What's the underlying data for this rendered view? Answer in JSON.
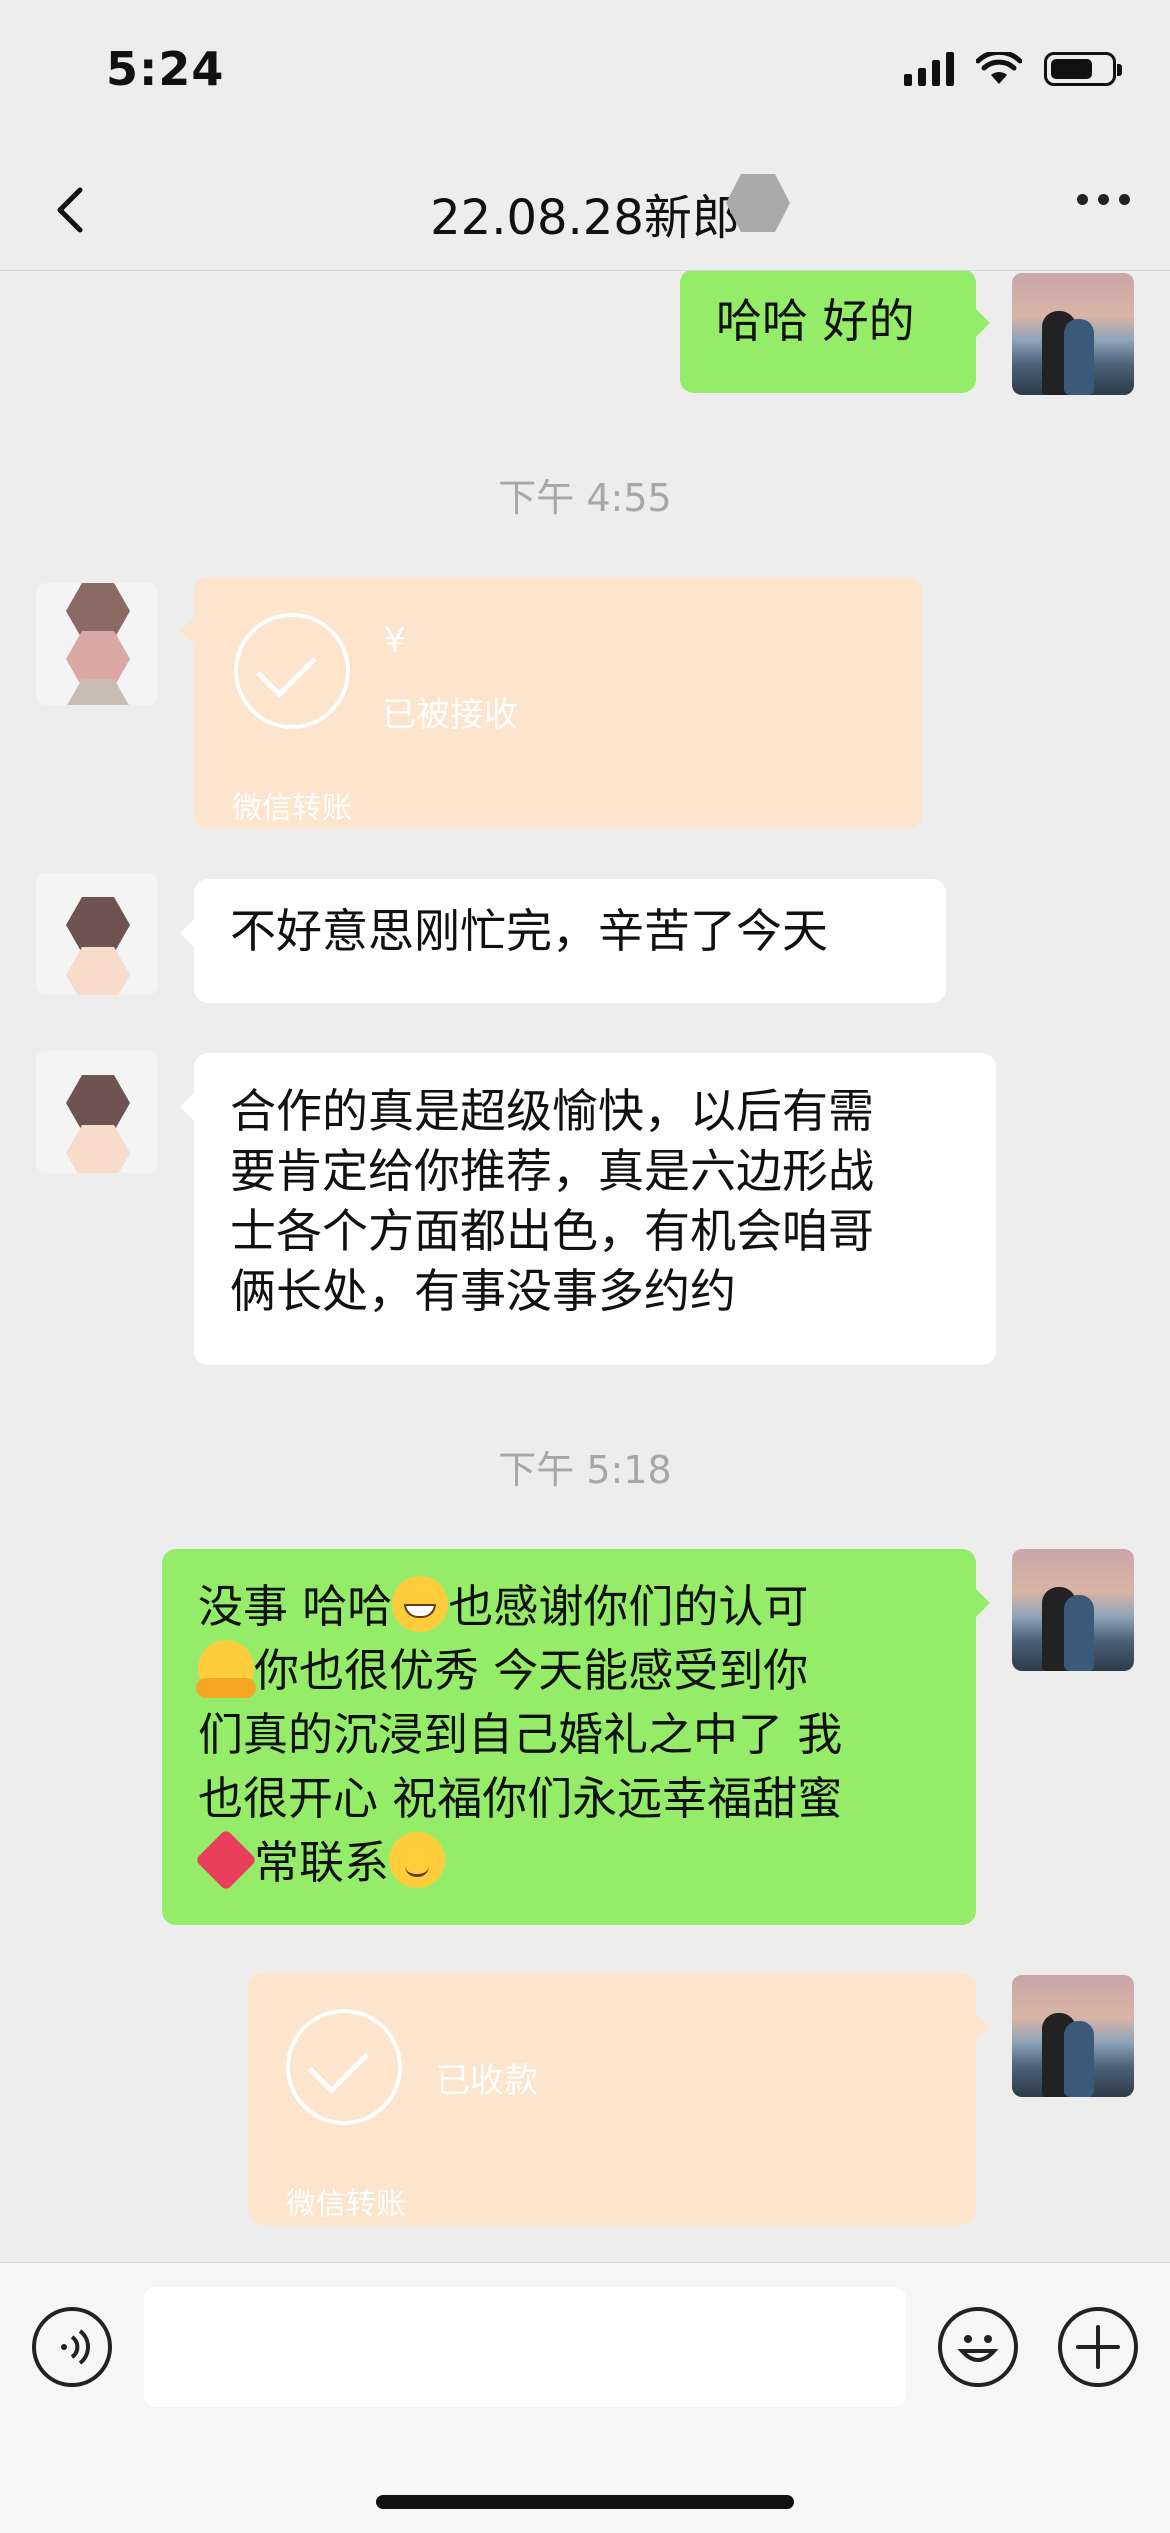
{
  "status_bar": {
    "time": "5:24",
    "battery_level": 0.7
  },
  "nav": {
    "title": "22.08.28新郎"
  },
  "messages": {
    "m1": {
      "text": "哈哈 好的"
    },
    "ts1": "下午 4:55",
    "transfer1": {
      "currency": "¥",
      "status": "已被接收",
      "footer": "微信转账"
    },
    "m2": {
      "text": "不好意思刚忙完，辛苦了今天"
    },
    "m3": {
      "lines": [
        "合作的真是超级愉快，以后有需",
        "要肯定给你推荐，真是六边形战",
        "士各个方面都出色，有机会咱哥",
        "俩长处，有事没事多约约"
      ]
    },
    "ts2": "下午 5:18",
    "m4": {
      "line1_a": "没事 哈哈",
      "line1_b": "也感谢你们的认可",
      "line2": "你也很优秀 今天能感受到你",
      "line3": "们真的沉浸到自己婚礼之中了 我",
      "line4": "也很开心 祝福你们永远幸福甜蜜",
      "line5": "常联系"
    },
    "transfer2": {
      "status": "已收款",
      "footer": "微信转账"
    }
  },
  "icons": {
    "back": "chevron-left-icon",
    "more": "more-dots-icon",
    "voice": "voice-icon",
    "emoji": "smiley-icon",
    "add": "plus-icon"
  },
  "colors": {
    "green_bubble": "#95ec69",
    "transfer": "#fde4cc",
    "background": "#ededed"
  }
}
